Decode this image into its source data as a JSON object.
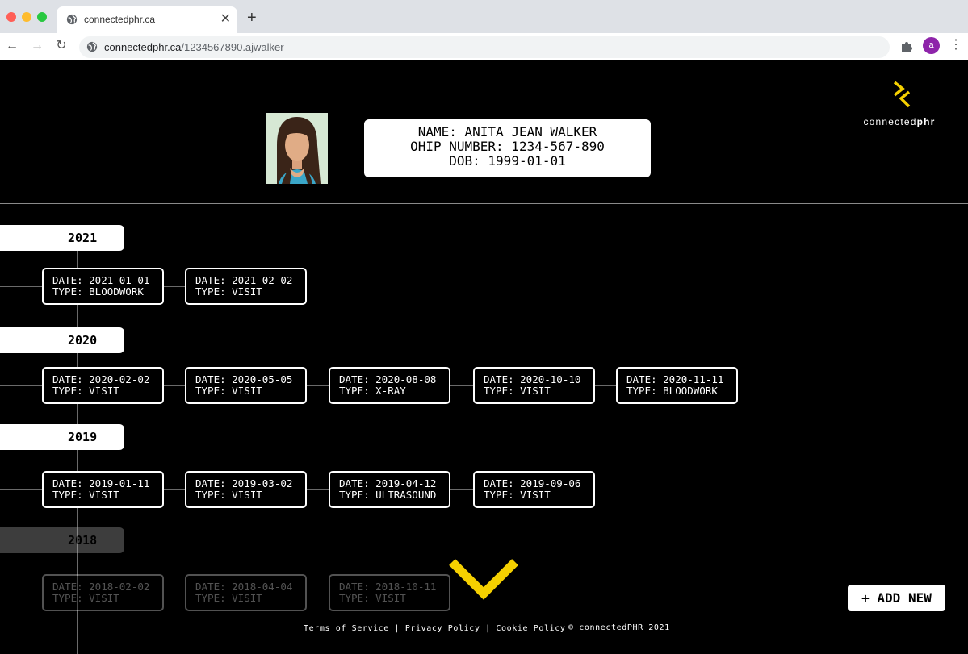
{
  "browser": {
    "tab_title": "connectedphr.ca",
    "url_host": "connectedphr.ca",
    "url_path": "/1234567890.ajwalker",
    "profile_initial": "a"
  },
  "header": {
    "logo_text_light": "connected",
    "logo_text_bold": "phr",
    "accent_color": "#f5d000"
  },
  "patient": {
    "name_line": "NAME: ANITA JEAN WALKER",
    "ohip_line": "OHIP NUMBER: 1234-567-890",
    "dob_line": "DOB: 1999-01-01"
  },
  "timeline": [
    {
      "year": "2021",
      "records": [
        {
          "date": "DATE: 2021-01-01",
          "type": "TYPE: BLOODWORK"
        },
        {
          "date": "DATE: 2021-02-02",
          "type": "TYPE: VISIT"
        }
      ]
    },
    {
      "year": "2020",
      "records": [
        {
          "date": "DATE: 2020-02-02",
          "type": "TYPE: VISIT"
        },
        {
          "date": "DATE: 2020-05-05",
          "type": "TYPE: VISIT"
        },
        {
          "date": "DATE: 2020-08-08",
          "type": "TYPE: X-RAY"
        },
        {
          "date": "DATE: 2020-10-10",
          "type": "TYPE: VISIT"
        },
        {
          "date": "DATE: 2020-11-11",
          "type": "TYPE: BLOODWORK"
        }
      ]
    },
    {
      "year": "2019",
      "records": [
        {
          "date": "DATE: 2019-01-11",
          "type": "TYPE: VISIT"
        },
        {
          "date": "DATE: 2019-03-02",
          "type": "TYPE: VISIT"
        },
        {
          "date": "DATE: 2019-04-12",
          "type": "TYPE: ULTRASOUND"
        },
        {
          "date": "DATE: 2019-09-06",
          "type": "TYPE: VISIT"
        }
      ]
    },
    {
      "year": "2018",
      "records": [
        {
          "date": "DATE: 2018-02-02",
          "type": "TYPE: VISIT"
        },
        {
          "date": "DATE: 2018-04-04",
          "type": "TYPE: VISIT"
        },
        {
          "date": "DATE: 2018-10-11",
          "type": "TYPE: VISIT"
        }
      ]
    }
  ],
  "actions": {
    "add_new": "+ ADD NEW",
    "scroll_icon": "chevron-down-icon"
  },
  "footer": {
    "terms": "Terms of Service",
    "privacy": "Privacy Policy",
    "cookie": "Cookie Policy",
    "separator": " | ",
    "copyright": "© connectedPHR 2021"
  }
}
